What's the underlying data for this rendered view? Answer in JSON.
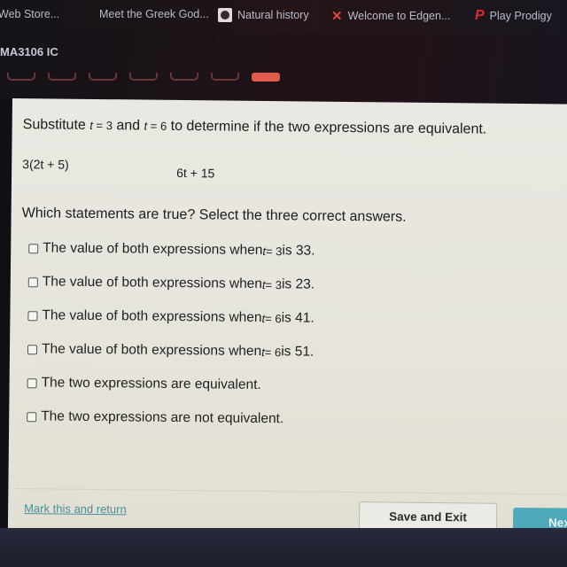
{
  "bookmarks": [
    {
      "label": "Web Store...",
      "icon": "web-store-icon"
    },
    {
      "label": "Meet the Greek God...",
      "icon": "none"
    },
    {
      "label": "Natural history",
      "icon": "natural-history-icon"
    },
    {
      "label": "Welcome to Edgen...",
      "icon": "edgenuity-icon"
    },
    {
      "label": "Play Prodigy",
      "icon": "prodigy-icon"
    }
  ],
  "course": {
    "title": "MA3106 IC"
  },
  "progress": {
    "total": 7,
    "current": 7
  },
  "question": {
    "prompt_parts": {
      "before": "Substitute ",
      "var1": "t",
      "eq1": " = 3",
      "and": " and ",
      "var2": "t",
      "eq2": " = 6",
      "after": " to determine if the two expressions are equivalent."
    },
    "expression1": "3(2t + 5)",
    "expression2": "6t + 15",
    "instruction": "Which statements are true? Select the three correct answers.",
    "options": [
      {
        "before": "The value of both expressions when ",
        "var": "t",
        "eq": " = 3",
        "after": " is 33.",
        "checked": false
      },
      {
        "before": "The value of both expressions when ",
        "var": "t",
        "eq": " = 3",
        "after": " is 23.",
        "checked": false
      },
      {
        "before": "The value of both expressions when ",
        "var": "t",
        "eq": " = 6",
        "after": " is 41.",
        "checked": false
      },
      {
        "before": "The value of both expressions when ",
        "var": "t",
        "eq": " = 6",
        "after": " is 51.",
        "checked": false
      },
      {
        "before": "The two expressions are equivalent.",
        "var": "",
        "eq": "",
        "after": "",
        "checked": false
      },
      {
        "before": "The two expressions are not equivalent.",
        "var": "",
        "eq": "",
        "after": "",
        "checked": false
      }
    ]
  },
  "footer": {
    "mark_link": "Mark this and return",
    "save_label": "Save and Exit",
    "next_label": "Next"
  },
  "colors": {
    "accent": "#4eaab8",
    "progress_current": "#e25a4c",
    "link": "#4a8f96"
  }
}
